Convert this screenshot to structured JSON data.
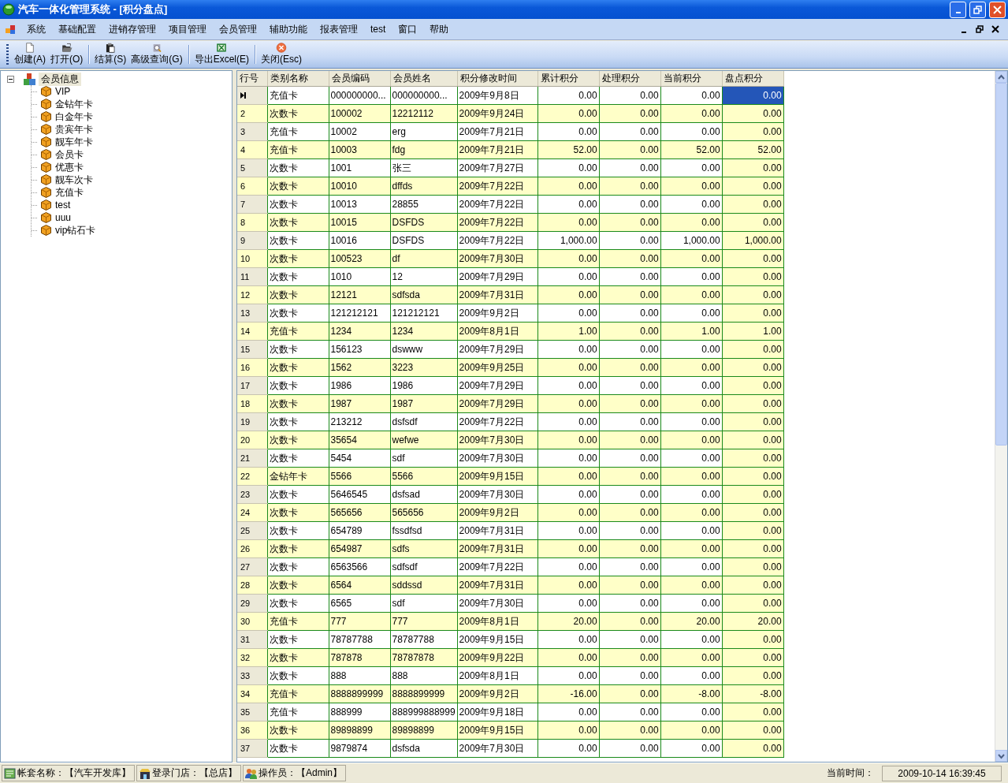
{
  "window": {
    "title": "汽车一体化管理系统 - [积分盘点]"
  },
  "menu": [
    {
      "label": "系统"
    },
    {
      "label": "基础配置"
    },
    {
      "label": "进销存管理"
    },
    {
      "label": "项目管理"
    },
    {
      "label": "会员管理"
    },
    {
      "label": "辅助功能"
    },
    {
      "label": "报表管理"
    },
    {
      "label": "test"
    },
    {
      "label": "窗口"
    },
    {
      "label": "帮助"
    }
  ],
  "toolbar": [
    [
      {
        "label": "创建(A)"
      },
      {
        "label": "打开(O)"
      }
    ],
    [
      {
        "label": "结算(S)"
      },
      {
        "label": "高级查询(G)"
      }
    ],
    [
      {
        "label": "导出Excel(E)"
      }
    ],
    [
      {
        "label": "关闭(Esc)"
      }
    ]
  ],
  "tree": {
    "label": "会员信息",
    "expanded": true,
    "selected": true,
    "children": [
      {
        "label": "VIP"
      },
      {
        "label": "金钻年卡"
      },
      {
        "label": "白金年卡"
      },
      {
        "label": "贵宾年卡"
      },
      {
        "label": "靓车年卡"
      },
      {
        "label": "会员卡"
      },
      {
        "label": "优惠卡"
      },
      {
        "label": "靓车次卡"
      },
      {
        "label": "充值卡"
      },
      {
        "label": "test"
      },
      {
        "label": "uuu"
      },
      {
        "label": "vip钻石卡"
      }
    ]
  },
  "grid": {
    "columns": [
      {
        "label": "行号",
        "kind": "header"
      },
      {
        "label": "类别名称",
        "kind": "text"
      },
      {
        "label": "会员编码",
        "kind": "text"
      },
      {
        "label": "会员姓名",
        "kind": "text"
      },
      {
        "label": "积分修改时间",
        "kind": "text"
      },
      {
        "label": "累计积分",
        "kind": "number"
      },
      {
        "label": "处理积分",
        "kind": "number"
      },
      {
        "label": "当前积分",
        "kind": "number"
      },
      {
        "label": "盘点积分",
        "kind": "input"
      }
    ],
    "rows": [
      {
        "selected": true,
        "cells": [
          "",
          "充值卡",
          "000000000...",
          "000000000...",
          "2009年9月8日",
          "0.00",
          "0.00",
          "0.00",
          "0.00"
        ]
      },
      {
        "selected": false,
        "cells": [
          "2",
          "次数卡",
          "100002",
          "12212112",
          "2009年9月24日",
          "0.00",
          "0.00",
          "0.00",
          "0.00"
        ]
      },
      {
        "selected": false,
        "cells": [
          "3",
          "充值卡",
          "10002",
          "erg",
          "2009年7月21日",
          "0.00",
          "0.00",
          "0.00",
          "0.00"
        ]
      },
      {
        "selected": false,
        "cells": [
          "4",
          "充值卡",
          "10003",
          "fdg",
          "2009年7月21日",
          "52.00",
          "0.00",
          "52.00",
          "52.00"
        ]
      },
      {
        "selected": false,
        "cells": [
          "5",
          "次数卡",
          "1001",
          "张三",
          "2009年7月27日",
          "0.00",
          "0.00",
          "0.00",
          "0.00"
        ]
      },
      {
        "selected": false,
        "cells": [
          "6",
          "次数卡",
          "10010",
          "dffds",
          "2009年7月22日",
          "0.00",
          "0.00",
          "0.00",
          "0.00"
        ]
      },
      {
        "selected": false,
        "cells": [
          "7",
          "次数卡",
          "10013",
          "28855",
          "2009年7月22日",
          "0.00",
          "0.00",
          "0.00",
          "0.00"
        ]
      },
      {
        "selected": false,
        "cells": [
          "8",
          "次数卡",
          "10015",
          "DSFDS",
          "2009年7月22日",
          "0.00",
          "0.00",
          "0.00",
          "0.00"
        ]
      },
      {
        "selected": false,
        "cells": [
          "9",
          "次数卡",
          "10016",
          "DSFDS",
          "2009年7月22日",
          "1,000.00",
          "0.00",
          "1,000.00",
          "1,000.00"
        ]
      },
      {
        "selected": false,
        "cells": [
          "10",
          "次数卡",
          "100523",
          "df",
          "2009年7月30日",
          "0.00",
          "0.00",
          "0.00",
          "0.00"
        ]
      },
      {
        "selected": false,
        "cells": [
          "11",
          "次数卡",
          "1010",
          "12",
          "2009年7月29日",
          "0.00",
          "0.00",
          "0.00",
          "0.00"
        ]
      },
      {
        "selected": false,
        "cells": [
          "12",
          "次数卡",
          "12121",
          "sdfsda",
          "2009年7月31日",
          "0.00",
          "0.00",
          "0.00",
          "0.00"
        ]
      },
      {
        "selected": false,
        "cells": [
          "13",
          "次数卡",
          "121212121",
          "121212121",
          "2009年9月2日",
          "0.00",
          "0.00",
          "0.00",
          "0.00"
        ]
      },
      {
        "selected": false,
        "cells": [
          "14",
          "充值卡",
          "1234",
          "1234",
          "2009年8月1日",
          "1.00",
          "0.00",
          "1.00",
          "1.00"
        ]
      },
      {
        "selected": false,
        "cells": [
          "15",
          "次数卡",
          "156123",
          "dswww",
          "2009年7月29日",
          "0.00",
          "0.00",
          "0.00",
          "0.00"
        ]
      },
      {
        "selected": false,
        "cells": [
          "16",
          "次数卡",
          "1562",
          "3223",
          "2009年9月25日",
          "0.00",
          "0.00",
          "0.00",
          "0.00"
        ]
      },
      {
        "selected": false,
        "cells": [
          "17",
          "次数卡",
          "1986",
          "1986",
          "2009年7月29日",
          "0.00",
          "0.00",
          "0.00",
          "0.00"
        ]
      },
      {
        "selected": false,
        "cells": [
          "18",
          "次数卡",
          "1987",
          "1987",
          "2009年7月29日",
          "0.00",
          "0.00",
          "0.00",
          "0.00"
        ]
      },
      {
        "selected": false,
        "cells": [
          "19",
          "次数卡",
          "213212",
          "dsfsdf",
          "2009年7月22日",
          "0.00",
          "0.00",
          "0.00",
          "0.00"
        ]
      },
      {
        "selected": false,
        "cells": [
          "20",
          "次数卡",
          "35654",
          "wefwe",
          "2009年7月30日",
          "0.00",
          "0.00",
          "0.00",
          "0.00"
        ]
      },
      {
        "selected": false,
        "cells": [
          "21",
          "次数卡",
          "5454",
          "sdf",
          "2009年7月30日",
          "0.00",
          "0.00",
          "0.00",
          "0.00"
        ]
      },
      {
        "selected": false,
        "cells": [
          "22",
          "金钻年卡",
          "5566",
          "5566",
          "2009年9月15日",
          "0.00",
          "0.00",
          "0.00",
          "0.00"
        ]
      },
      {
        "selected": false,
        "cells": [
          "23",
          "次数卡",
          "5646545",
          "dsfsad",
          "2009年7月30日",
          "0.00",
          "0.00",
          "0.00",
          "0.00"
        ]
      },
      {
        "selected": false,
        "cells": [
          "24",
          "次数卡",
          "565656",
          "565656",
          "2009年9月2日",
          "0.00",
          "0.00",
          "0.00",
          "0.00"
        ]
      },
      {
        "selected": false,
        "cells": [
          "25",
          "次数卡",
          "654789",
          "fssdfsd",
          "2009年7月31日",
          "0.00",
          "0.00",
          "0.00",
          "0.00"
        ]
      },
      {
        "selected": false,
        "cells": [
          "26",
          "次数卡",
          "654987",
          "sdfs",
          "2009年7月31日",
          "0.00",
          "0.00",
          "0.00",
          "0.00"
        ]
      },
      {
        "selected": false,
        "cells": [
          "27",
          "次数卡",
          "6563566",
          "sdfsdf",
          "2009年7月22日",
          "0.00",
          "0.00",
          "0.00",
          "0.00"
        ]
      },
      {
        "selected": false,
        "cells": [
          "28",
          "次数卡",
          "6564",
          "sddssd",
          "2009年7月31日",
          "0.00",
          "0.00",
          "0.00",
          "0.00"
        ]
      },
      {
        "selected": false,
        "cells": [
          "29",
          "次数卡",
          "6565",
          "sdf",
          "2009年7月30日",
          "0.00",
          "0.00",
          "0.00",
          "0.00"
        ]
      },
      {
        "selected": false,
        "cells": [
          "30",
          "充值卡",
          "777",
          "777",
          "2009年8月1日",
          "20.00",
          "0.00",
          "20.00",
          "20.00"
        ]
      },
      {
        "selected": false,
        "cells": [
          "31",
          "次数卡",
          "78787788",
          "78787788",
          "2009年9月15日",
          "0.00",
          "0.00",
          "0.00",
          "0.00"
        ]
      },
      {
        "selected": false,
        "cells": [
          "32",
          "次数卡",
          "787878",
          "78787878",
          "2009年9月22日",
          "0.00",
          "0.00",
          "0.00",
          "0.00"
        ]
      },
      {
        "selected": false,
        "cells": [
          "33",
          "次数卡",
          "888",
          "888",
          "2009年8月1日",
          "0.00",
          "0.00",
          "0.00",
          "0.00"
        ]
      },
      {
        "selected": false,
        "cells": [
          "34",
          "充值卡",
          "8888899999",
          "8888899999",
          "2009年9月2日",
          "-16.00",
          "0.00",
          "-8.00",
          "-8.00"
        ]
      },
      {
        "selected": false,
        "cells": [
          "35",
          "充值卡",
          "888999",
          "888999888999",
          "2009年9月18日",
          "0.00",
          "0.00",
          "0.00",
          "0.00"
        ]
      },
      {
        "selected": false,
        "cells": [
          "36",
          "次数卡",
          "89898899",
          "89898899",
          "2009年9月15日",
          "0.00",
          "0.00",
          "0.00",
          "0.00"
        ]
      },
      {
        "selected": false,
        "cells": [
          "37",
          "次数卡",
          "9879874",
          "dsfsda",
          "2009年7月30日",
          "0.00",
          "0.00",
          "0.00",
          "0.00"
        ]
      }
    ]
  },
  "status_bar": {
    "panels": [
      {
        "text": "帐套名称：【汽车开发库】"
      },
      {
        "text": "登录门店：【总店】"
      },
      {
        "text": "操作员：【Admin】"
      }
    ],
    "time_label": "当前时间：",
    "time": "2009-10-14 16:39:45"
  }
}
